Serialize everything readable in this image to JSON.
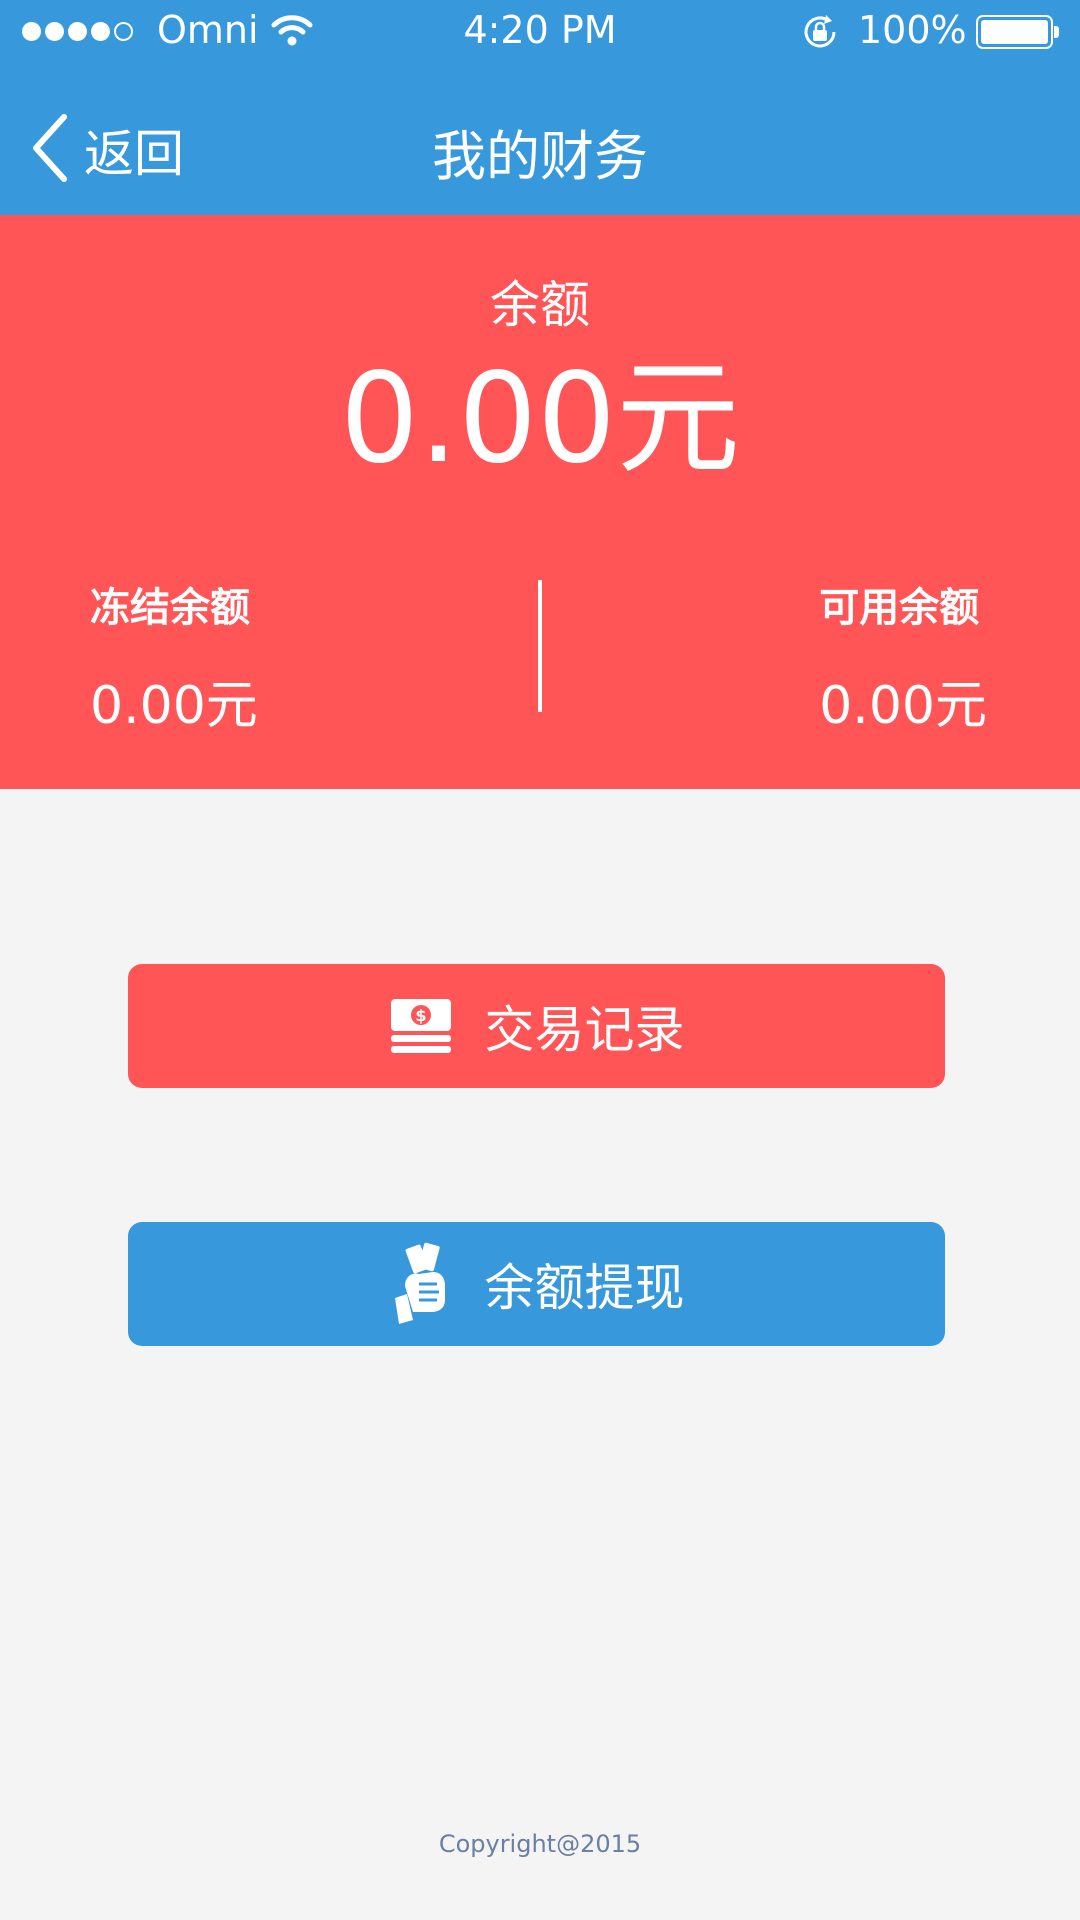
{
  "status_bar": {
    "carrier": "Omni",
    "time": "4:20 PM",
    "battery_percent": "100%",
    "signal_bars_filled": 4,
    "signal_bars_total": 5
  },
  "nav": {
    "back_label": "返回",
    "title": "我的财务"
  },
  "balance": {
    "label": "余额",
    "value": "0.00元",
    "frozen_label": "冻结余额",
    "frozen_value": "0.00元",
    "available_label": "可用余额",
    "available_value": "0.00元"
  },
  "actions": {
    "records_label": "交易记录",
    "records_icon": "money-stack-icon",
    "withdraw_label": "余额提现",
    "withdraw_icon": "hand-money-icon"
  },
  "footer": {
    "copyright": "Copyright@2015"
  },
  "colors": {
    "header_blue": "#3799db",
    "accent_red": "#ff5557",
    "background": "#f4f4f4"
  }
}
